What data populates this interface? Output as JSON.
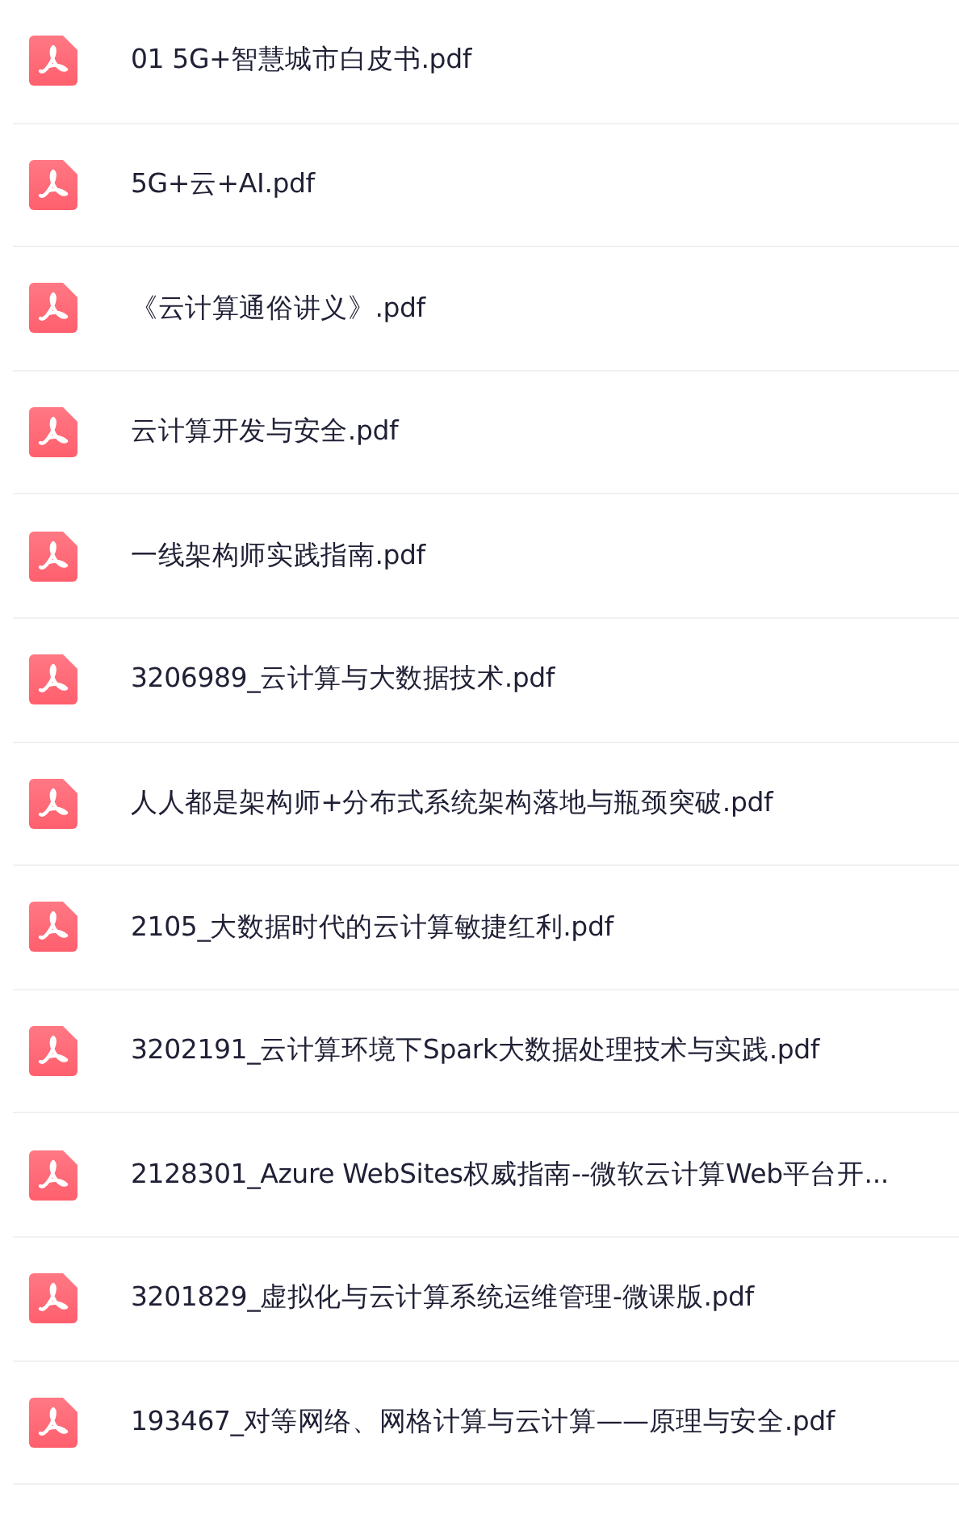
{
  "files": [
    {
      "name": "01 5G+智慧城市白皮书.pdf"
    },
    {
      "name": "5G+云+AI.pdf"
    },
    {
      "name": "《云计算通俗讲义》.pdf"
    },
    {
      "name": "云计算开发与安全.pdf"
    },
    {
      "name": "一线架构师实践指南.pdf"
    },
    {
      "name": "3206989_云计算与大数据技术.pdf"
    },
    {
      "name": "人人都是架构师+分布式系统架构落地与瓶颈突破.pdf"
    },
    {
      "name": "2105_大数据时代的云计算敏捷红利.pdf"
    },
    {
      "name": "3202191_云计算环境下Spark大数据处理技术与实践.pdf"
    },
    {
      "name": "2128301_Azure WebSites权威指南--微软云计算Web平台开..."
    },
    {
      "name": "3201829_虚拟化与云计算系统运维管理-微课版.pdf"
    },
    {
      "name": "193467_对等网络、网格计算与云计算——原理与安全.pdf"
    }
  ]
}
